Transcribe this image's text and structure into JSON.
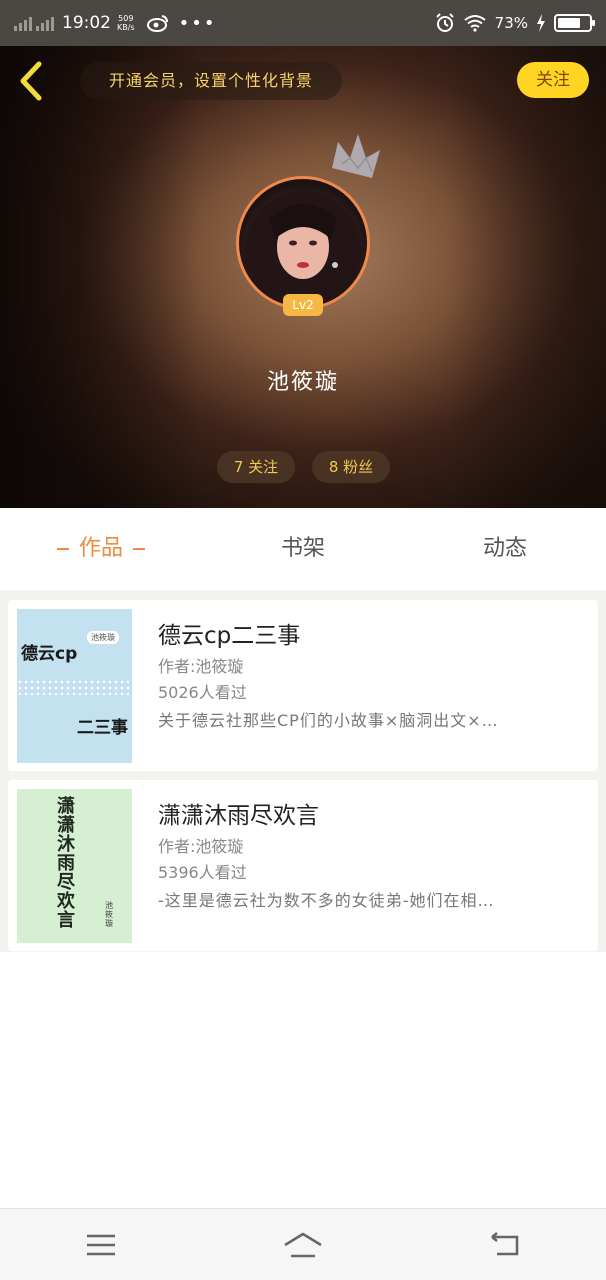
{
  "status_bar": {
    "time": "19:02",
    "net_speed_value": "509",
    "net_speed_unit": "KB/s",
    "battery": "73%",
    "icons": [
      "signal-icon",
      "weibo-icon",
      "more-dots-icon",
      "alarm-icon",
      "wifi-icon",
      "charging-icon",
      "battery-icon"
    ],
    "battery_level": 0.73
  },
  "header": {
    "vip_banner": "开通会员，设置个性化背景",
    "follow_label": "关注",
    "level": "Lv2",
    "username": "池筱璇",
    "following": "7 关注",
    "fans": "8 粉丝"
  },
  "tabs": [
    {
      "label": "作品",
      "active": true
    },
    {
      "label": "书架",
      "active": false
    },
    {
      "label": "动态",
      "active": false
    }
  ],
  "works": [
    {
      "title": "德云cp二三事",
      "author": "作者:池筱璇",
      "views": "5026人看过",
      "desc": "关于德云社那些CP们的小故事×脑洞出文×…",
      "cover_title_top": "德云cp",
      "cover_tag": "池筱璇",
      "cover_title_bottom": "二三事"
    },
    {
      "title": "潇潇沐雨尽欢言",
      "author": "作者:池筱璇",
      "views": "5396人看过",
      "desc": "-这里是德云社为数不多的女徒弟-她们在相…",
      "cover_title_vertical": "潇潇沐雨尽欢言",
      "cover_tag": "池筱璇"
    }
  ],
  "colors": {
    "accent": "#ef8a45",
    "follow_yellow": "#ffd422",
    "vip_text": "#f6d467"
  },
  "nav_icons": [
    "menu-icon",
    "home-icon",
    "back-icon"
  ]
}
